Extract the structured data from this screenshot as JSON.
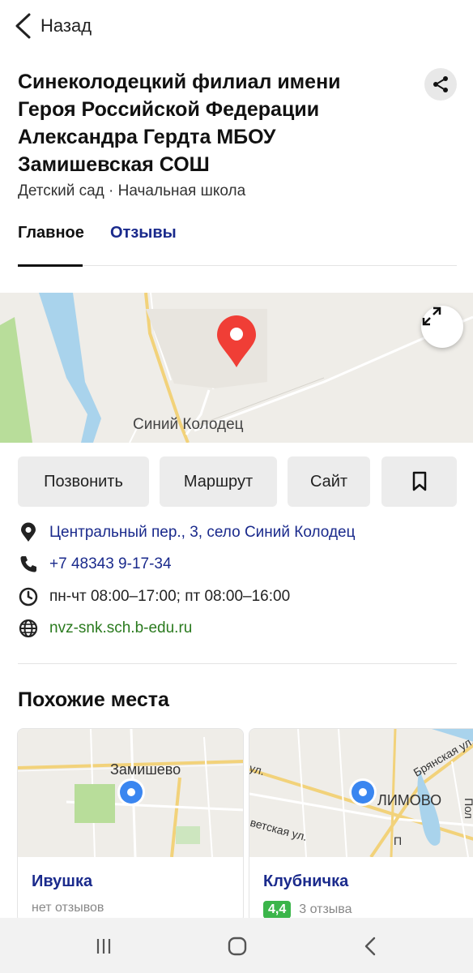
{
  "header": {
    "back_label": "Назад"
  },
  "place": {
    "title": "Синеколодецкий филиал имени Героя Российской Федерации Александра Гердта МБОУ Замишевская СОШ",
    "categories": "Детский сад · Начальная школа"
  },
  "tabs": [
    {
      "label": "Главное",
      "active": true
    },
    {
      "label": "Отзывы",
      "active": false
    }
  ],
  "map": {
    "label": "Синий Колодец"
  },
  "actions": {
    "call": "Позвонить",
    "route": "Маршрут",
    "site": "Сайт",
    "bookmark_icon": "bookmark-icon"
  },
  "info": {
    "address": "Центральный пер., 3, село Синий Колодец",
    "phone": "+7 48343 9-17-34",
    "hours": "пн-чт 08:00–17:00; пт 08:00–16:00",
    "website": "nvz-snk.sch.b-edu.ru"
  },
  "similar": {
    "title": "Похожие места",
    "cards": [
      {
        "name": "Ивушка",
        "map_label": "Замишево",
        "reviews": "нет отзывов"
      },
      {
        "name": "Клубничка",
        "map_label": "ЛИМОВО",
        "rating": "4,4",
        "reviews": "3 отзыва",
        "street_1": "Брянская ул.",
        "street_2": "ул.",
        "street_3": "ветская ул.",
        "street_4": "Пол",
        "street_5": "П"
      }
    ]
  },
  "colors": {
    "link": "#1a2a8c",
    "website": "#2a7a1e",
    "pin": "#f03e36",
    "location_dot": "#3a86f0",
    "rating": "#3bb54a"
  }
}
